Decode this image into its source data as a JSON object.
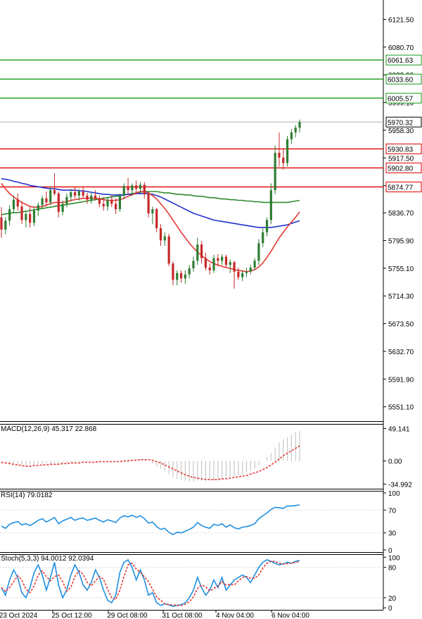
{
  "colors": {
    "bull": "#2e7d32",
    "bear": "#c62828",
    "ma_fast": "#e53935",
    "ma_mid": "#2233cc",
    "ma_slow": "#2e8b2e",
    "support": "#e00000",
    "resistance": "#1a9c1a",
    "indicator_line": "#1f8fe0",
    "signal": "#e53935",
    "hist": "#c8c8c8",
    "grid": "#d9d9d9"
  },
  "chart_data": [
    {
      "type": "candlestick",
      "ylim": [
        5530,
        6150
      ],
      "y_ticks": [
        6121.5,
        6080.7,
        6039.9,
        5999.1,
        5958.3,
        5917.5,
        5876.7,
        5836.7,
        5795.9,
        5755.1,
        5714.3,
        5673.5,
        5632.7,
        5591.9,
        5551.1
      ],
      "y_tick_labels": [
        "6121.50",
        "6080.70",
        "6039.90",
        "5999.10",
        "5958.30",
        "5917.50",
        "",
        "5836.70",
        "5795.90",
        "5755.10",
        "5714.30",
        "5673.50",
        "5632.70",
        "5591.90",
        "5551.10"
      ],
      "x_labels": [
        "23 Oct 2024",
        "25 Oct 12:00",
        "29 Oct 08:00",
        "31 Oct 08:00",
        "4 Nov 04:00",
        "6 Nov 04:00"
      ],
      "current_price": 5970.32,
      "current_price_label": "5970.32",
      "resistance_levels": [
        {
          "value": 6061.63,
          "label": "6061.63"
        },
        {
          "value": 6033.6,
          "label": "6033.60"
        },
        {
          "value": 6005.57,
          "label": "6005.57"
        }
      ],
      "support_levels": [
        {
          "value": 5930.83,
          "label": "5930.83"
        },
        {
          "value": 5902.8,
          "label": "5902.80"
        },
        {
          "value": 5874.77,
          "label": "5874.77"
        }
      ],
      "ohlc": [
        [
          5830,
          5845,
          5800,
          5812
        ],
        [
          5812,
          5830,
          5805,
          5825
        ],
        [
          5825,
          5848,
          5818,
          5842
        ],
        [
          5842,
          5862,
          5836,
          5856
        ],
        [
          5856,
          5865,
          5840,
          5846
        ],
        [
          5846,
          5852,
          5820,
          5826
        ],
        [
          5826,
          5840,
          5815,
          5835
        ],
        [
          5835,
          5845,
          5815,
          5822
        ],
        [
          5822,
          5845,
          5817,
          5840
        ],
        [
          5840,
          5852,
          5832,
          5848
        ],
        [
          5848,
          5862,
          5842,
          5858
        ],
        [
          5858,
          5868,
          5846,
          5852
        ],
        [
          5852,
          5875,
          5848,
          5870
        ],
        [
          5870,
          5895,
          5862,
          5865
        ],
        [
          5865,
          5868,
          5830,
          5838
        ],
        [
          5838,
          5855,
          5833,
          5850
        ],
        [
          5850,
          5865,
          5845,
          5860
        ],
        [
          5860,
          5872,
          5853,
          5867
        ],
        [
          5867,
          5874,
          5858,
          5862
        ],
        [
          5862,
          5872,
          5855,
          5868
        ],
        [
          5868,
          5876,
          5858,
          5862
        ],
        [
          5862,
          5866,
          5850,
          5856
        ],
        [
          5856,
          5866,
          5850,
          5862
        ],
        [
          5862,
          5870,
          5855,
          5858
        ],
        [
          5858,
          5862,
          5845,
          5850
        ],
        [
          5850,
          5860,
          5840,
          5846
        ],
        [
          5846,
          5860,
          5840,
          5856
        ],
        [
          5856,
          5862,
          5845,
          5850
        ],
        [
          5850,
          5858,
          5835,
          5842
        ],
        [
          5842,
          5865,
          5838,
          5862
        ],
        [
          5862,
          5880,
          5857,
          5876
        ],
        [
          5876,
          5888,
          5864,
          5870
        ],
        [
          5870,
          5880,
          5862,
          5877
        ],
        [
          5877,
          5884,
          5866,
          5872
        ],
        [
          5872,
          5882,
          5866,
          5878
        ],
        [
          5878,
          5882,
          5858,
          5864
        ],
        [
          5864,
          5868,
          5830,
          5836
        ],
        [
          5836,
          5846,
          5820,
          5842
        ],
        [
          5842,
          5844,
          5808,
          5814
        ],
        [
          5814,
          5820,
          5788,
          5796
        ],
        [
          5796,
          5808,
          5788,
          5802
        ],
        [
          5802,
          5806,
          5758,
          5762
        ],
        [
          5762,
          5765,
          5730,
          5738
        ],
        [
          5738,
          5752,
          5730,
          5748
        ],
        [
          5748,
          5752,
          5734,
          5740
        ],
        [
          5740,
          5752,
          5732,
          5746
        ],
        [
          5746,
          5760,
          5740,
          5755
        ],
        [
          5755,
          5772,
          5750,
          5766
        ],
        [
          5766,
          5800,
          5760,
          5790
        ],
        [
          5790,
          5795,
          5762,
          5770
        ],
        [
          5770,
          5778,
          5752,
          5756
        ],
        [
          5756,
          5762,
          5746,
          5752
        ],
        [
          5752,
          5775,
          5748,
          5770
        ],
        [
          5770,
          5776,
          5758,
          5766
        ],
        [
          5766,
          5776,
          5760,
          5772
        ],
        [
          5772,
          5775,
          5756,
          5760
        ],
        [
          5760,
          5768,
          5748,
          5764
        ],
        [
          5764,
          5766,
          5725,
          5750
        ],
        [
          5750,
          5756,
          5738,
          5742
        ],
        [
          5742,
          5752,
          5736,
          5748
        ],
        [
          5748,
          5756,
          5742,
          5750
        ],
        [
          5750,
          5760,
          5746,
          5756
        ],
        [
          5756,
          5770,
          5752,
          5766
        ],
        [
          5766,
          5798,
          5760,
          5792
        ],
        [
          5792,
          5814,
          5786,
          5808
        ],
        [
          5808,
          5830,
          5802,
          5826
        ],
        [
          5826,
          5880,
          5820,
          5870
        ],
        [
          5870,
          5936,
          5864,
          5925
        ],
        [
          5925,
          5955,
          5905,
          5918
        ],
        [
          5918,
          5930,
          5900,
          5910
        ],
        [
          5910,
          5950,
          5905,
          5945
        ],
        [
          5945,
          5960,
          5938,
          5955
        ],
        [
          5955,
          5966,
          5948,
          5962
        ],
        [
          5962,
          5974,
          5955,
          5970.32
        ]
      ],
      "ma_fast": [
        5880,
        5872,
        5865,
        5860,
        5856,
        5852,
        5849,
        5846,
        5845,
        5845,
        5846,
        5848,
        5850,
        5852,
        5852,
        5852,
        5853,
        5855,
        5856,
        5857,
        5858,
        5858,
        5858,
        5858,
        5857,
        5856,
        5855,
        5855,
        5855,
        5856,
        5858,
        5861,
        5863,
        5866,
        5868,
        5868,
        5866,
        5862,
        5857,
        5850,
        5843,
        5835,
        5826,
        5817,
        5808,
        5800,
        5792,
        5785,
        5779,
        5774,
        5769,
        5765,
        5762,
        5760,
        5758,
        5756,
        5755,
        5753,
        5752,
        5751,
        5750,
        5751,
        5753,
        5757,
        5763,
        5771,
        5780,
        5790,
        5800,
        5808,
        5816,
        5823,
        5830,
        5838
      ],
      "ma_mid": [
        5887,
        5886,
        5885,
        5883,
        5882,
        5880,
        5879,
        5877,
        5876,
        5875,
        5874,
        5873,
        5872,
        5872,
        5871,
        5870,
        5870,
        5870,
        5870,
        5869,
        5869,
        5868,
        5867,
        5866,
        5865,
        5864,
        5864,
        5863,
        5863,
        5863,
        5863,
        5864,
        5864,
        5865,
        5865,
        5865,
        5865,
        5864,
        5862,
        5860,
        5857,
        5854,
        5851,
        5848,
        5845,
        5842,
        5839,
        5836,
        5834,
        5832,
        5830,
        5828,
        5826,
        5825,
        5824,
        5823,
        5822,
        5821,
        5820,
        5819,
        5818,
        5817,
        5816,
        5815,
        5815,
        5815,
        5815,
        5816,
        5817,
        5818,
        5819,
        5821,
        5823,
        5825
      ],
      "ma_slow": [
        5834,
        5835,
        5836,
        5837,
        5837,
        5838,
        5839,
        5840,
        5841,
        5842,
        5843,
        5844,
        5845,
        5846,
        5847,
        5848,
        5849,
        5850,
        5851,
        5852,
        5853,
        5854,
        5855,
        5856,
        5857,
        5858,
        5859,
        5860,
        5861,
        5862,
        5863,
        5864,
        5865,
        5866,
        5867,
        5868,
        5868,
        5868,
        5868,
        5867,
        5866,
        5866,
        5865,
        5864,
        5864,
        5863,
        5863,
        5862,
        5861,
        5861,
        5860,
        5859,
        5859,
        5858,
        5857,
        5857,
        5856,
        5856,
        5855,
        5855,
        5854,
        5854,
        5853,
        5853,
        5852,
        5852,
        5852,
        5852,
        5852,
        5852,
        5852,
        5853,
        5854,
        5855
      ]
    },
    {
      "type": "macd",
      "label": "MACD(12,26,9) 45.317 22.868",
      "params": "12,26,9",
      "macd_value": 45.317,
      "signal_value": 22.868,
      "ylim": [
        -42,
        56
      ],
      "y_ticks": [
        49.141,
        0.0,
        -34.992
      ],
      "y_tick_labels": [
        "49.141",
        "0.00",
        "-34.992"
      ],
      "histogram": [
        -1,
        -2,
        -3,
        -4,
        -5,
        -6,
        -7,
        -6,
        -6,
        -5,
        -5,
        -4,
        -4,
        -3,
        -4,
        -4,
        -3,
        -3,
        -2,
        -2,
        -2,
        -1,
        -1,
        -1,
        -1,
        -1,
        -1,
        -1,
        -1,
        0,
        1,
        2,
        2,
        3,
        3,
        2,
        0,
        -4,
        -8,
        -12,
        -16,
        -20,
        -24,
        -27,
        -29,
        -30,
        -31,
        -31,
        -30,
        -30,
        -30,
        -29,
        -29,
        -28,
        -27,
        -26,
        -25,
        -24,
        -22,
        -20,
        -18,
        -15,
        -12,
        -6,
        0,
        6,
        12,
        20,
        28,
        33,
        36,
        40,
        44,
        45.3
      ],
      "signal": [
        -2,
        -3,
        -4,
        -5,
        -6,
        -7,
        -8,
        -8,
        -7,
        -7,
        -6,
        -6,
        -5,
        -5,
        -5,
        -4,
        -4,
        -3,
        -3,
        -3,
        -2,
        -2,
        -2,
        -2,
        -1,
        -1,
        -1,
        -1,
        -1,
        -1,
        0,
        0,
        1,
        1,
        2,
        2,
        2,
        1,
        -1,
        -3,
        -6,
        -9,
        -12,
        -15,
        -18,
        -21,
        -23,
        -25,
        -26,
        -27,
        -28,
        -28,
        -28,
        -28,
        -27,
        -27,
        -26,
        -25,
        -24,
        -23,
        -22,
        -20,
        -18,
        -16,
        -13,
        -10,
        -6,
        -2,
        3,
        8,
        12,
        15,
        19,
        22.9
      ]
    },
    {
      "type": "line",
      "label": "RSI(14) 79.0182",
      "params": "14",
      "value": 79.0182,
      "ylim": [
        0,
        100
      ],
      "y_ticks": [
        100,
        70,
        30,
        0
      ],
      "y_tick_labels": [
        "100",
        "70",
        "30",
        "0"
      ],
      "values": [
        42,
        38,
        45,
        48,
        50,
        44,
        46,
        43,
        47,
        52,
        55,
        49,
        53,
        57,
        46,
        51,
        54,
        57,
        52,
        55,
        56,
        52,
        54,
        56,
        52,
        49,
        53,
        51,
        48,
        56,
        60,
        58,
        61,
        57,
        60,
        55,
        47,
        49,
        41,
        36,
        38,
        31,
        27,
        31,
        30,
        33,
        36,
        40,
        48,
        43,
        40,
        38,
        45,
        43,
        46,
        40,
        44,
        39,
        37,
        40,
        41,
        43,
        46,
        55,
        60,
        65,
        71,
        75,
        74,
        73,
        77,
        77,
        78,
        79
      ]
    },
    {
      "type": "line",
      "label": "Stoch(5,3,3) 94.0012 92.0394",
      "params": "5,3,3",
      "k_value": 94.0012,
      "d_value": 92.0394,
      "ylim": [
        -4,
        106
      ],
      "y_ticks": [
        100,
        80,
        20,
        0
      ],
      "y_tick_labels": [
        "100",
        "80",
        "20",
        "0"
      ],
      "k": [
        40,
        25,
        55,
        75,
        60,
        30,
        20,
        40,
        70,
        85,
        65,
        35,
        60,
        90,
        45,
        20,
        35,
        65,
        85,
        70,
        45,
        35,
        50,
        75,
        60,
        35,
        15,
        10,
        25,
        70,
        90,
        95,
        80,
        55,
        75,
        55,
        25,
        30,
        10,
        5,
        8,
        6,
        3,
        5,
        6,
        10,
        20,
        35,
        60,
        40,
        25,
        35,
        55,
        40,
        60,
        35,
        45,
        55,
        60,
        65,
        60,
        50,
        65,
        80,
        90,
        95,
        92,
        88,
        85,
        87,
        90,
        88,
        92,
        94
      ]
    }
  ]
}
